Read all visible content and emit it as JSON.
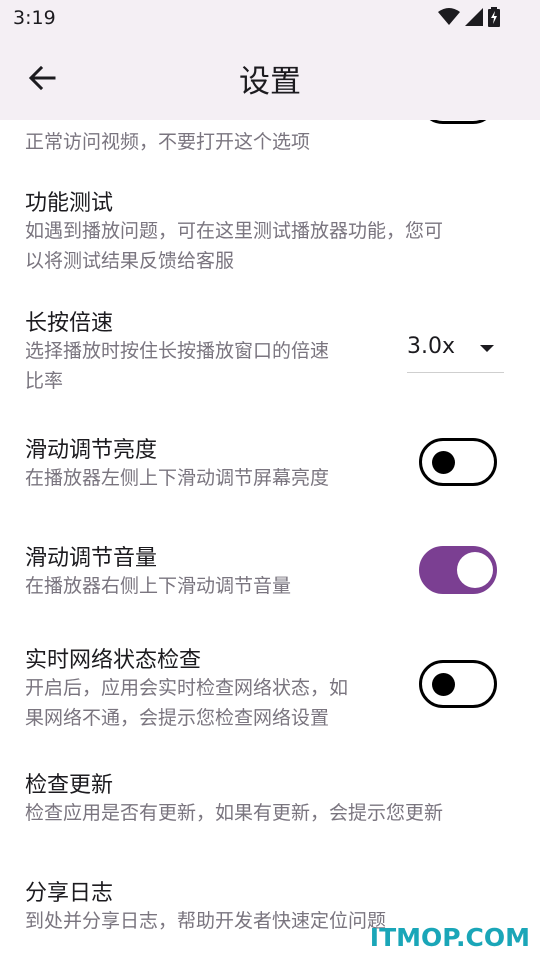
{
  "status_bar": {
    "time": "3:19",
    "icons": [
      "wifi-icon",
      "signal-icon",
      "battery-charging-icon"
    ]
  },
  "app_bar": {
    "title": "设置",
    "back_icon": "arrow-back-icon"
  },
  "settings": {
    "partial_top": {
      "desc": "正常访问视频，不要打开这个选项"
    },
    "function_test": {
      "title": "功能测试",
      "desc": "如遇到播放问题，可在这里测试播放器功能，您可\n以将测试结果反馈给客服"
    },
    "long_press_speed": {
      "title": "长按倍速",
      "desc": "选择播放时按住长按播放窗口的倍速\n比率",
      "value": "3.0x"
    },
    "swipe_brightness": {
      "title": "滑动调节亮度",
      "desc": "在播放器左侧上下滑动调节屏幕亮度",
      "enabled": false
    },
    "swipe_volume": {
      "title": "滑动调节音量",
      "desc": "在播放器右侧上下滑动调节音量",
      "enabled": true
    },
    "network_check": {
      "title": "实时网络状态检查",
      "desc": "开启后，应用会实时检查网络状态，如\n果网络不通，会提示您检查网络设置",
      "enabled": false
    },
    "check_update": {
      "title": "检查更新",
      "desc": "检查应用是否有更新，如果有更新，会提示您更新"
    },
    "share_log": {
      "title": "分享日志",
      "desc": "到处并分享日志，帮助开发者快速定位问题"
    }
  },
  "watermark": "ITMOP.COM",
  "colors": {
    "accent": "#7b3f92",
    "app_bar_bg": "#f4eff4",
    "secondary_text": "#7a757f"
  }
}
